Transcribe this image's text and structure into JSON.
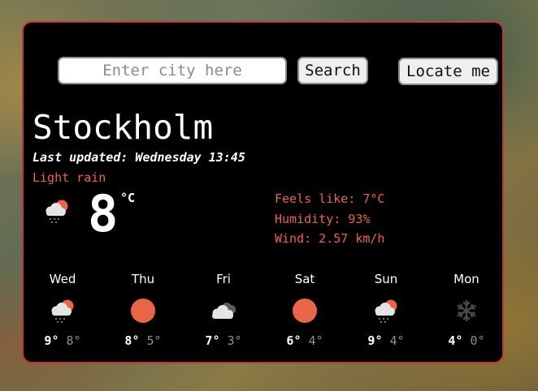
{
  "search": {
    "placeholder": "Enter city here",
    "search_label": "Search",
    "locate_label": "Locate me"
  },
  "current": {
    "city": "Stockholm",
    "last_updated": "Last updated: Wednesday 13:45",
    "description": "Light rain",
    "icon": "light-rain-icon",
    "temperature": "8",
    "unit": "°C",
    "feels_like": "Feels like: 7°C",
    "humidity": "Humidity: 93%",
    "wind": "Wind: 2.57 km/h"
  },
  "forecast": [
    {
      "day": "Wed",
      "icon": "light-rain-icon",
      "max": "9°",
      "min": "8°"
    },
    {
      "day": "Thu",
      "icon": "sun-icon",
      "max": "8°",
      "min": "5°"
    },
    {
      "day": "Fri",
      "icon": "clouds-icon",
      "max": "7°",
      "min": "3°"
    },
    {
      "day": "Sat",
      "icon": "sun-icon",
      "max": "6°",
      "min": "4°"
    },
    {
      "day": "Sun",
      "icon": "light-rain-icon",
      "max": "9°",
      "min": "4°"
    },
    {
      "day": "Mon",
      "icon": "snow-icon",
      "max": "4°",
      "min": "0°"
    }
  ],
  "colors": {
    "accent": "#e8654a",
    "border": "#c0353c",
    "card": "#000000"
  }
}
